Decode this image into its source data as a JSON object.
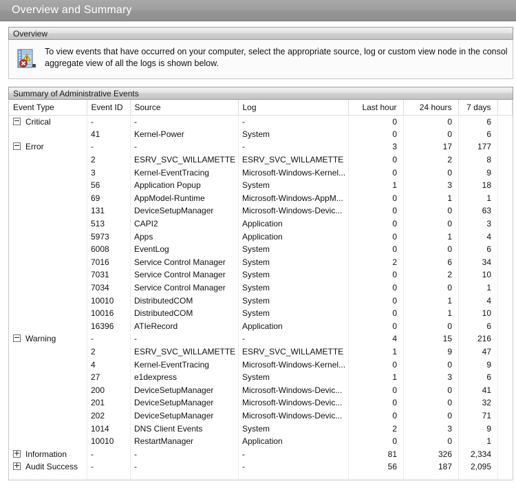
{
  "window": {
    "title": "Overview and Summary"
  },
  "overview": {
    "header": "Overview",
    "icon": "event-log-icon",
    "line1": "To view events that have occurred on your computer, select the appropriate source, log or custom view node in the console tree. The A",
    "line2": "aggregate view of all the logs is shown below."
  },
  "summary": {
    "header": "Summary of Administrative Events",
    "columns": [
      "Event Type",
      "Event ID",
      "Source",
      "Log",
      "Last hour",
      "24 hours",
      "7 days"
    ],
    "rows": [
      {
        "group": true,
        "state": "collapse",
        "type": "Critical",
        "id": "-",
        "source": "-",
        "log": "-",
        "last_hour": "0",
        "24_hours": "0",
        "7_days": "6"
      },
      {
        "group": false,
        "type": "",
        "id": "41",
        "source": "Kernel-Power",
        "log": "System",
        "last_hour": "0",
        "24_hours": "0",
        "7_days": "6"
      },
      {
        "group": true,
        "state": "collapse",
        "type": "Error",
        "id": "-",
        "source": "-",
        "log": "-",
        "last_hour": "3",
        "24_hours": "17",
        "7_days": "177"
      },
      {
        "group": false,
        "type": "",
        "id": "2",
        "source": "ESRV_SVC_WILLAMETTE",
        "log": "ESRV_SVC_WILLAMETTE",
        "last_hour": "0",
        "24_hours": "2",
        "7_days": "8"
      },
      {
        "group": false,
        "type": "",
        "id": "3",
        "source": "Kernel-EventTracing",
        "log": "Microsoft-Windows-Kernel...",
        "last_hour": "0",
        "24_hours": "0",
        "7_days": "9"
      },
      {
        "group": false,
        "type": "",
        "id": "56",
        "source": "Application Popup",
        "log": "System",
        "last_hour": "1",
        "24_hours": "3",
        "7_days": "18"
      },
      {
        "group": false,
        "type": "",
        "id": "69",
        "source": "AppModel-Runtime",
        "log": "Microsoft-Windows-AppM...",
        "last_hour": "0",
        "24_hours": "1",
        "7_days": "1"
      },
      {
        "group": false,
        "type": "",
        "id": "131",
        "source": "DeviceSetupManager",
        "log": "Microsoft-Windows-Devic...",
        "last_hour": "0",
        "24_hours": "0",
        "7_days": "63"
      },
      {
        "group": false,
        "type": "",
        "id": "513",
        "source": "CAPI2",
        "log": "Application",
        "last_hour": "0",
        "24_hours": "0",
        "7_days": "3"
      },
      {
        "group": false,
        "type": "",
        "id": "5973",
        "source": "Apps",
        "log": "Application",
        "last_hour": "0",
        "24_hours": "1",
        "7_days": "4"
      },
      {
        "group": false,
        "type": "",
        "id": "6008",
        "source": "EventLog",
        "log": "System",
        "last_hour": "0",
        "24_hours": "0",
        "7_days": "6"
      },
      {
        "group": false,
        "type": "",
        "id": "7016",
        "source": "Service Control Manager",
        "log": "System",
        "last_hour": "2",
        "24_hours": "6",
        "7_days": "34"
      },
      {
        "group": false,
        "type": "",
        "id": "7031",
        "source": "Service Control Manager",
        "log": "System",
        "last_hour": "0",
        "24_hours": "2",
        "7_days": "10"
      },
      {
        "group": false,
        "type": "",
        "id": "7034",
        "source": "Service Control Manager",
        "log": "System",
        "last_hour": "0",
        "24_hours": "0",
        "7_days": "1"
      },
      {
        "group": false,
        "type": "",
        "id": "10010",
        "source": "DistributedCOM",
        "log": "System",
        "last_hour": "0",
        "24_hours": "1",
        "7_days": "4"
      },
      {
        "group": false,
        "type": "",
        "id": "10016",
        "source": "DistributedCOM",
        "log": "System",
        "last_hour": "0",
        "24_hours": "1",
        "7_days": "10"
      },
      {
        "group": false,
        "type": "",
        "id": "16396",
        "source": "ATIeRecord",
        "log": "Application",
        "last_hour": "0",
        "24_hours": "0",
        "7_days": "6"
      },
      {
        "group": true,
        "state": "collapse",
        "type": "Warning",
        "id": "-",
        "source": "-",
        "log": "-",
        "last_hour": "4",
        "24_hours": "15",
        "7_days": "216"
      },
      {
        "group": false,
        "type": "",
        "id": "2",
        "source": "ESRV_SVC_WILLAMETTE",
        "log": "ESRV_SVC_WILLAMETTE",
        "last_hour": "1",
        "24_hours": "9",
        "7_days": "47"
      },
      {
        "group": false,
        "type": "",
        "id": "4",
        "source": "Kernel-EventTracing",
        "log": "Microsoft-Windows-Kernel...",
        "last_hour": "0",
        "24_hours": "0",
        "7_days": "9"
      },
      {
        "group": false,
        "type": "",
        "id": "27",
        "source": "e1dexpress",
        "log": "System",
        "last_hour": "1",
        "24_hours": "3",
        "7_days": "6"
      },
      {
        "group": false,
        "type": "",
        "id": "200",
        "source": "DeviceSetupManager",
        "log": "Microsoft-Windows-Devic...",
        "last_hour": "0",
        "24_hours": "0",
        "7_days": "41"
      },
      {
        "group": false,
        "type": "",
        "id": "201",
        "source": "DeviceSetupManager",
        "log": "Microsoft-Windows-Devic...",
        "last_hour": "0",
        "24_hours": "0",
        "7_days": "32"
      },
      {
        "group": false,
        "type": "",
        "id": "202",
        "source": "DeviceSetupManager",
        "log": "Microsoft-Windows-Devic...",
        "last_hour": "0",
        "24_hours": "0",
        "7_days": "71"
      },
      {
        "group": false,
        "type": "",
        "id": "1014",
        "source": "DNS Client Events",
        "log": "System",
        "last_hour": "2",
        "24_hours": "3",
        "7_days": "9"
      },
      {
        "group": false,
        "type": "",
        "id": "10010",
        "source": "RestartManager",
        "log": "Application",
        "last_hour": "0",
        "24_hours": "0",
        "7_days": "1"
      },
      {
        "group": true,
        "state": "expand",
        "type": "Information",
        "id": "-",
        "source": "-",
        "log": "-",
        "last_hour": "81",
        "24_hours": "326",
        "7_days": "2,334"
      },
      {
        "group": true,
        "state": "expand",
        "type": "Audit Success",
        "id": "-",
        "source": "-",
        "log": "-",
        "last_hour": "56",
        "24_hours": "187",
        "7_days": "2,095"
      }
    ]
  }
}
